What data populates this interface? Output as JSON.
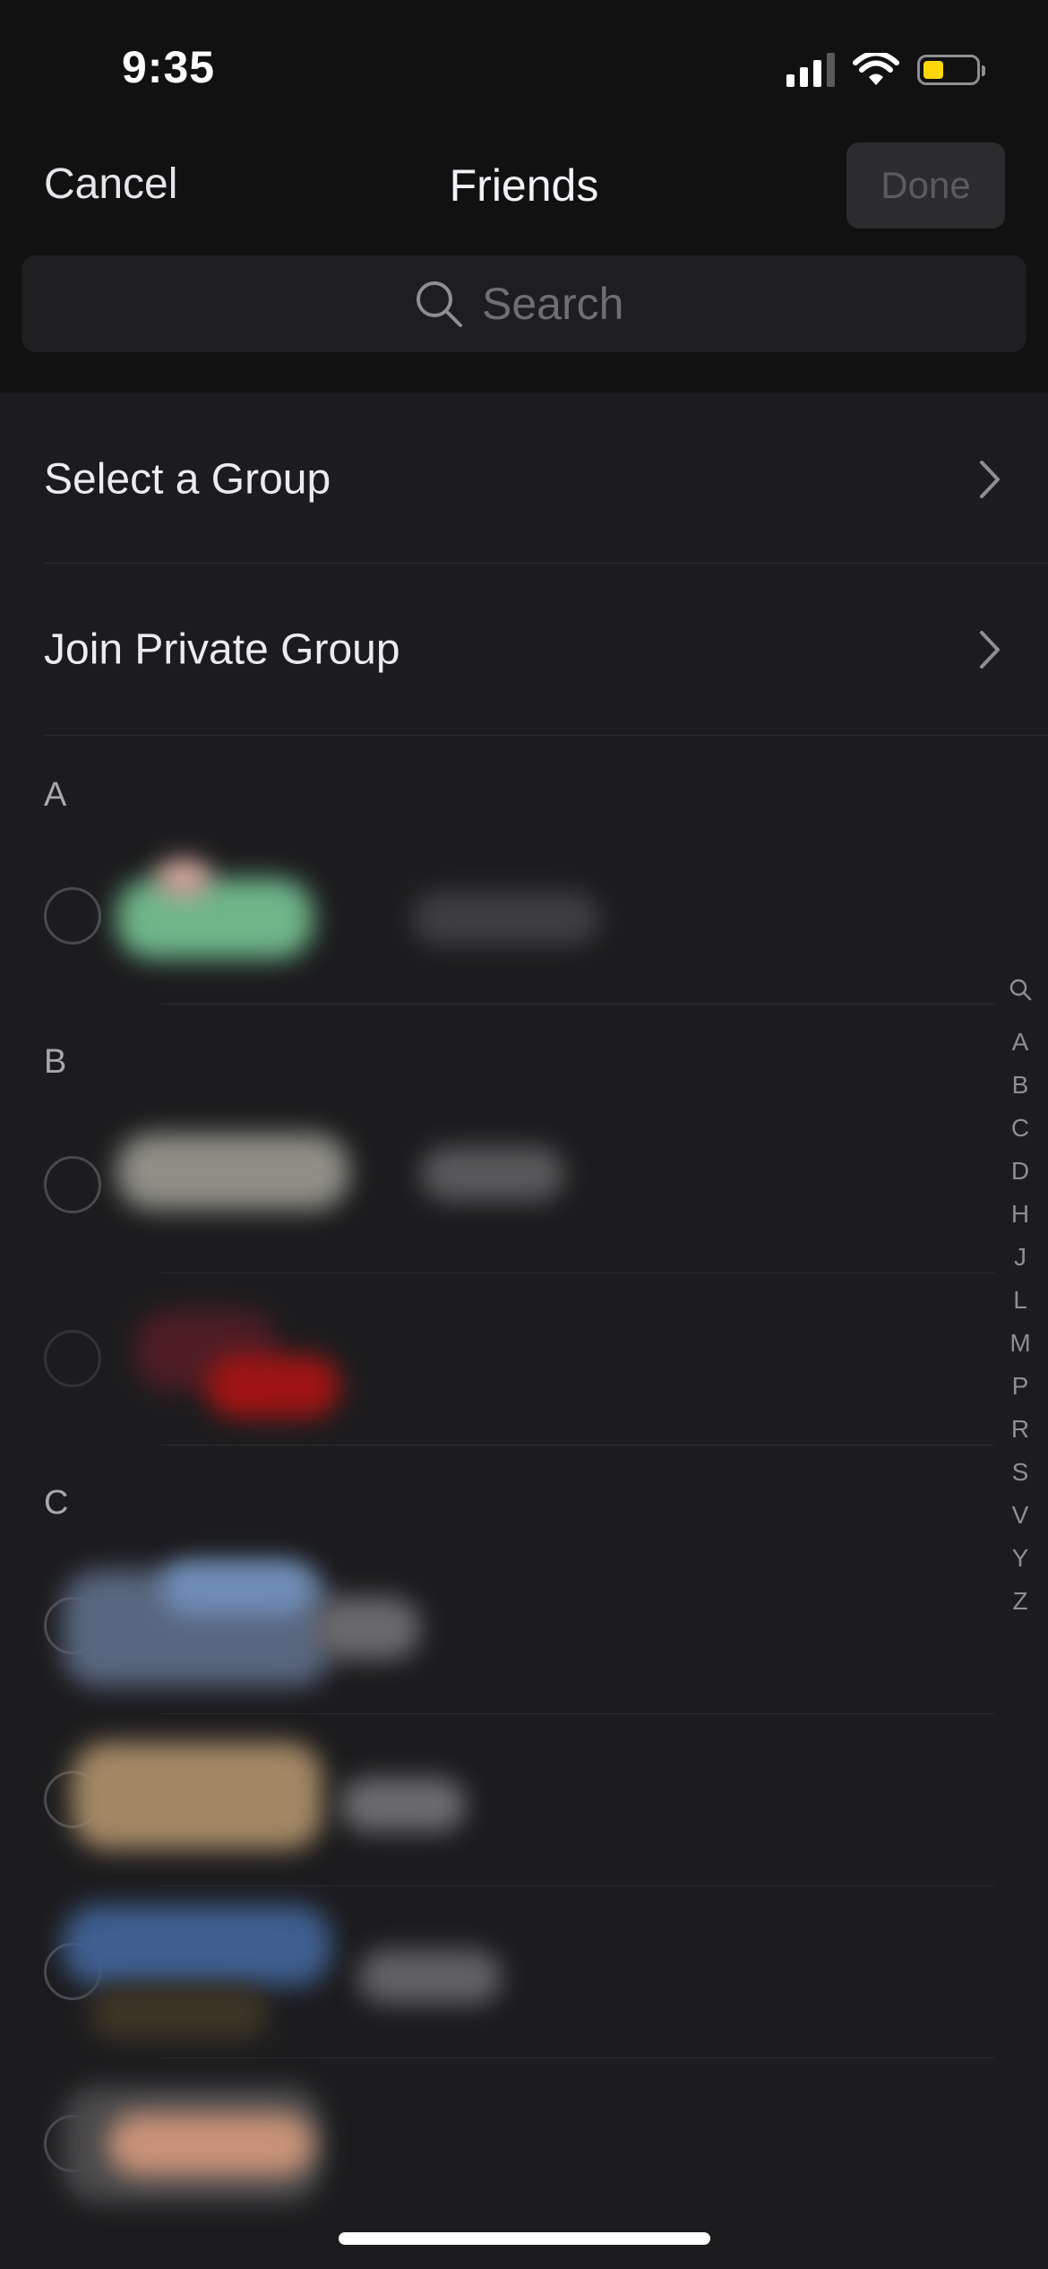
{
  "status_bar": {
    "time": "9:35",
    "icons": [
      "cellular-signal-icon",
      "wifi-icon",
      "battery-icon"
    ],
    "battery_level": 0.4,
    "battery_color": "#ffd60a"
  },
  "nav": {
    "cancel_label": "Cancel",
    "title": "Friends",
    "done_label": "Done"
  },
  "search": {
    "placeholder": "Search",
    "value": ""
  },
  "menu_rows": [
    {
      "label": "Select a Group",
      "icon": "chevron-right-icon"
    },
    {
      "label": "Join Private Group",
      "icon": "chevron-right-icon"
    }
  ],
  "sections": [
    {
      "letter": "A",
      "contacts": 1
    },
    {
      "letter": "B",
      "contacts": 2
    },
    {
      "letter": "C",
      "contacts": 4
    }
  ],
  "alpha_index": [
    "A",
    "B",
    "C",
    "D",
    "H",
    "J",
    "L",
    "M",
    "P",
    "R",
    "S",
    "V",
    "Y",
    "Z"
  ],
  "colors": {
    "background": "#1c1c1e",
    "header_background": "#111112",
    "accent_disabled": "#5c5c60"
  }
}
